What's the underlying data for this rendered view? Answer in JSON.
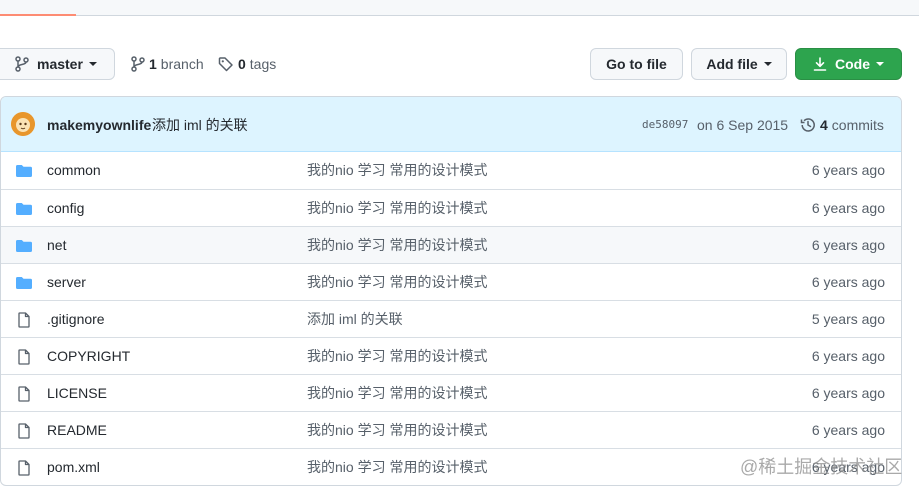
{
  "topbar": {},
  "toolbar": {
    "branch_label": "master",
    "branches_count": "1",
    "branches_label": "branch",
    "tags_count": "0",
    "tags_label": "tags",
    "goto_label": "Go to file",
    "add_label": "Add file",
    "code_label": "Code"
  },
  "commit": {
    "author": "makemyownlife",
    "message": "添加 iml 的关联",
    "sha": "de58097",
    "date": "on 6 Sep 2015",
    "commits_count": "4",
    "commits_label": "commits"
  },
  "files": [
    {
      "name": "common",
      "type": "folder",
      "message": "我的nio 学习 常用的设计模式",
      "age": "6 years ago"
    },
    {
      "name": "config",
      "type": "folder",
      "message": "我的nio 学习 常用的设计模式",
      "age": "6 years ago"
    },
    {
      "name": "net",
      "type": "folder",
      "message": "我的nio 学习 常用的设计模式",
      "age": "6 years ago"
    },
    {
      "name": "server",
      "type": "folder",
      "message": "我的nio 学习 常用的设计模式",
      "age": "6 years ago"
    },
    {
      "name": ".gitignore",
      "type": "file",
      "message": "添加 iml 的关联",
      "age": "5 years ago"
    },
    {
      "name": "COPYRIGHT",
      "type": "file",
      "message": "我的nio 学习 常用的设计模式",
      "age": "6 years ago"
    },
    {
      "name": "LICENSE",
      "type": "file",
      "message": "我的nio 学习 常用的设计模式",
      "age": "6 years ago"
    },
    {
      "name": "README",
      "type": "file",
      "message": "我的nio 学习 常用的设计模式",
      "age": "6 years ago"
    },
    {
      "name": "pom.xml",
      "type": "file",
      "message": "我的nio 学习 常用的设计模式",
      "age": "6 years ago"
    }
  ],
  "watermark": "@稀土掘金技术社区",
  "colors": {
    "accent_green": "#2da44e",
    "commit_bar": "#ddf4ff",
    "folder_icon": "#54aeff",
    "tab_underline": "#fd8c73"
  },
  "icons": {
    "branch": "git-branch-icon",
    "tag": "tag-icon",
    "download": "download-icon",
    "history": "history-icon",
    "folder": "folder-icon",
    "file": "file-icon"
  }
}
